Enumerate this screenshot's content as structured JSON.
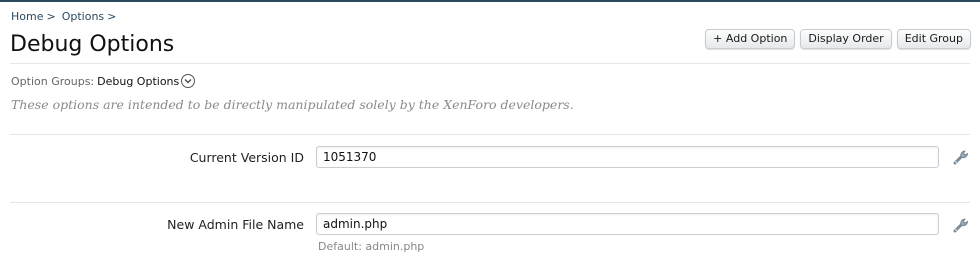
{
  "breadcrumb": {
    "items": [
      "Home",
      "Options"
    ],
    "separator": ">"
  },
  "page": {
    "title": "Debug Options"
  },
  "toolbar": {
    "add_option_label": "+ Add Option",
    "display_order_label": "Display Order",
    "edit_group_label": "Edit Group"
  },
  "option_group": {
    "label": "Option Groups:",
    "value": "Debug Options",
    "dropdown_icon": "chevron-down-circle-icon"
  },
  "description": "These options are intended to be directly manipulated solely by the XenForo developers.",
  "options": [
    {
      "label": "Current Version ID",
      "value": "1051370",
      "action_icon": "wrench-icon"
    },
    {
      "label": "New Admin File Name",
      "value": "admin.php",
      "default_hint": "Default: admin.php",
      "action_icon": "wrench-icon"
    }
  ],
  "colors": {
    "link": "#2b4a60",
    "description": "#8a8a8a",
    "rule": "#e4e6e9"
  }
}
